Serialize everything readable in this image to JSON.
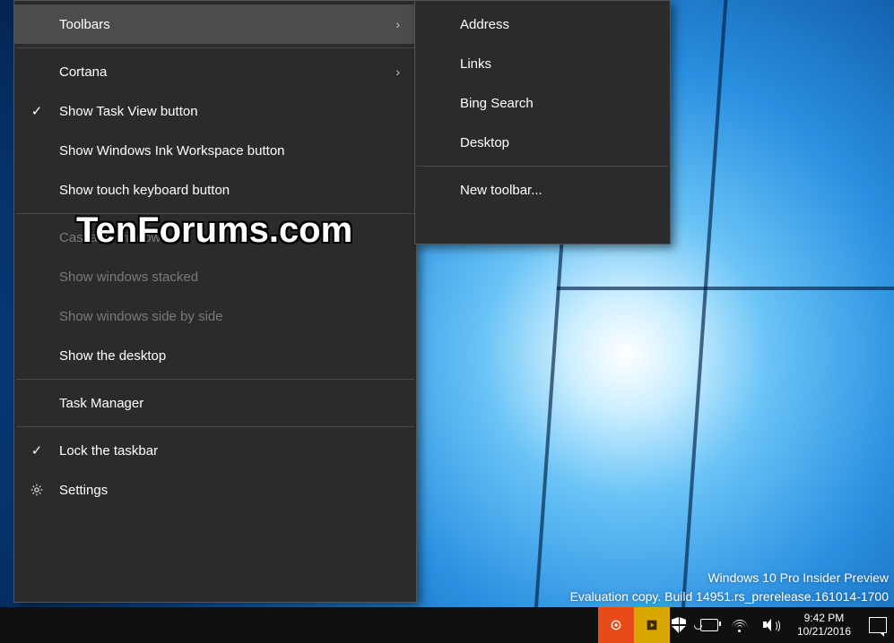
{
  "main_menu": {
    "items": [
      {
        "label": "Toolbars",
        "arrow": true,
        "highlight": true
      },
      {
        "sep": true
      },
      {
        "label": "Cortana",
        "arrow": true
      },
      {
        "label": "Show Task View button",
        "checked": true
      },
      {
        "label": "Show Windows Ink Workspace button"
      },
      {
        "label": "Show touch keyboard button"
      },
      {
        "sep": true
      },
      {
        "label": "Cascade windows",
        "disabled": true
      },
      {
        "label": "Show windows stacked",
        "disabled": true
      },
      {
        "label": "Show windows side by side",
        "disabled": true
      },
      {
        "label": "Show the desktop"
      },
      {
        "sep": true
      },
      {
        "label": "Task Manager"
      },
      {
        "sep": true
      },
      {
        "label": "Lock the taskbar",
        "checked": true
      },
      {
        "label": "Settings",
        "gear": true
      }
    ]
  },
  "sub_menu": {
    "items": [
      {
        "label": "Address"
      },
      {
        "label": "Links"
      },
      {
        "label": "Bing Search"
      },
      {
        "label": "Desktop"
      },
      {
        "sep": true
      },
      {
        "label": "New toolbar..."
      }
    ]
  },
  "watermark": {
    "forum": "TenForums.com",
    "edition": "Windows 10 Pro Insider Preview",
    "build": "Evaluation copy. Build 14951.rs_prerelease.161014-1700"
  },
  "tray": {
    "time": "9:42 PM",
    "date": "10/21/2016"
  }
}
